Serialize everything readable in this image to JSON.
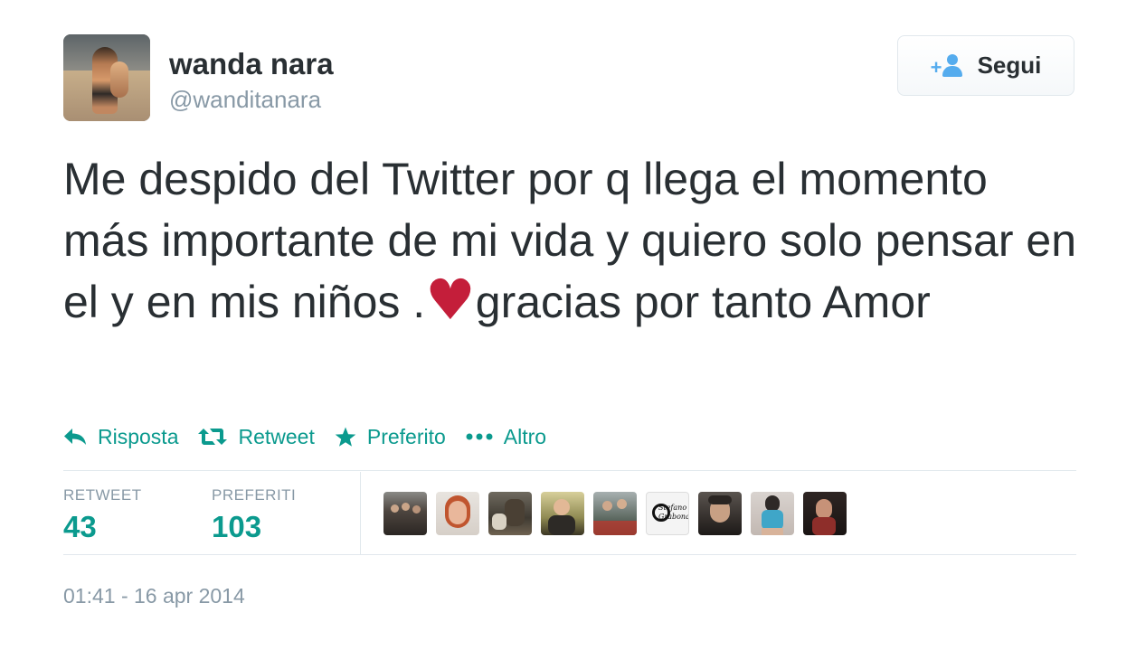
{
  "author": {
    "name": "wanda nara",
    "handle": "@wanditanara"
  },
  "follow_button": {
    "label": "Segui",
    "icon": "add-user-icon"
  },
  "tweet": {
    "text_before_heart": "Me despido del Twitter por q llega el momento más importante de mi vida y quiero solo pensar en el y en mis niños .",
    "heart": "♥",
    "text_after_heart": "gracias por tanto Amor"
  },
  "actions": [
    {
      "label": "Risposta",
      "icon": "reply-icon"
    },
    {
      "label": "Retweet",
      "icon": "retweet-icon"
    },
    {
      "label": "Preferito",
      "icon": "star-icon"
    },
    {
      "label": "Altro",
      "icon": "more-icon"
    }
  ],
  "stats": {
    "retweet_label": "RETWEET",
    "retweet_count": "43",
    "favorites_label": "PREFERITI",
    "favorites_count": "103"
  },
  "favoriters": [
    {
      "name": "favoriter-avatar-1",
      "caption": ""
    },
    {
      "name": "favoriter-avatar-2",
      "caption": ""
    },
    {
      "name": "favoriter-avatar-3",
      "caption": ""
    },
    {
      "name": "favoriter-avatar-4",
      "caption": ""
    },
    {
      "name": "favoriter-avatar-5",
      "caption": ""
    },
    {
      "name": "favoriter-avatar-6",
      "caption": "Stefano Grabona"
    },
    {
      "name": "favoriter-avatar-7",
      "caption": ""
    },
    {
      "name": "favoriter-avatar-8",
      "caption": ""
    },
    {
      "name": "favoriter-avatar-9",
      "caption": ""
    }
  ],
  "timestamp": "01:41 - 16 apr 2014",
  "colors": {
    "accent": "#0b9a8e",
    "heart": "#c41e3a",
    "muted": "#8899a6",
    "follow_icon": "#55acee"
  }
}
